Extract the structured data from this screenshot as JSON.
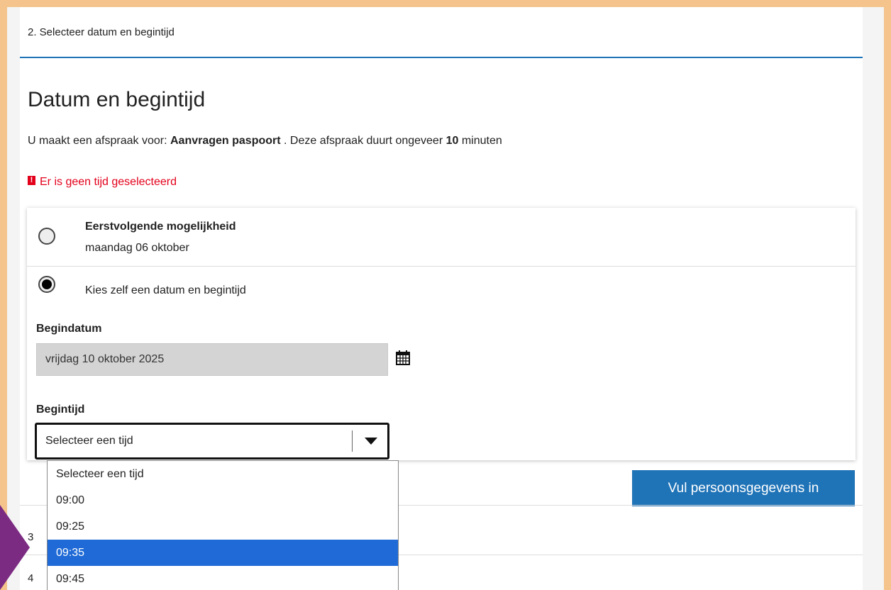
{
  "step_header": "2. Selecteer datum en begintijd",
  "title": "Datum en begintijd",
  "intro": {
    "prefix": "U maakt een afspraak voor: ",
    "service": "Aanvragen paspoort",
    "middle": " . Deze afspraak duurt ongeveer ",
    "duration": "10",
    "suffix": " minuten"
  },
  "error": {
    "icon": "!",
    "text": "Er is geen tijd geselecteerd"
  },
  "option_first": {
    "title": "Eerstvolgende mogelijkheid",
    "date": "maandag 06 oktober",
    "checked": false
  },
  "option_custom": {
    "label": "Kies zelf een datum en begintijd",
    "checked": true
  },
  "begindatum": {
    "label": "Begindatum",
    "value": "vrijdag 10 oktober 2025",
    "icon": "calendar-icon"
  },
  "begintijd": {
    "label": "Begintijd",
    "value": "Selecteer een tijd",
    "icon": "chevron-down-icon"
  },
  "dropdown": {
    "options": [
      "Selecteer een tijd",
      "09:00",
      "09:25",
      "09:35",
      "09:45"
    ],
    "highlighted": "09:35"
  },
  "next_button": "Vul persoonsgegevens in",
  "steps_below": [
    {
      "number": "3"
    },
    {
      "number": "4"
    }
  ],
  "colors": {
    "frame": "#f4c48c",
    "accent": "#1f73b7",
    "error": "#e3001b",
    "highlight": "#1f6ad6",
    "pointer": "#7b2b82"
  }
}
